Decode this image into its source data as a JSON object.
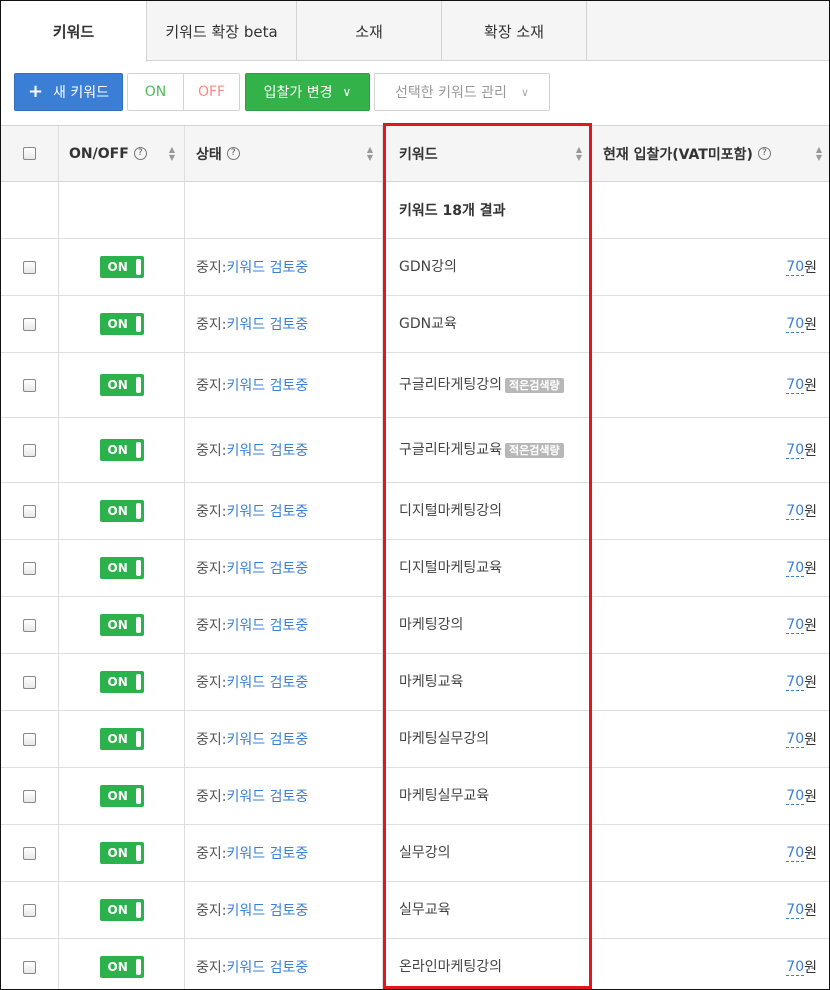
{
  "tabs": [
    {
      "label": "키워드",
      "active": true
    },
    {
      "label": "키워드 확장 beta",
      "active": false
    },
    {
      "label": "소재",
      "active": false
    },
    {
      "label": "확장 소재",
      "active": false
    }
  ],
  "toolbar": {
    "new_keyword": "새 키워드",
    "on": "ON",
    "off": "OFF",
    "bid_change": "입찰가 변경",
    "manage_selected": "선택한 키워드 관리"
  },
  "columns": {
    "onoff": "ON/OFF",
    "status": "상태",
    "keyword": "키워드",
    "bid": "현재 입찰가(VAT미포함)"
  },
  "result_summary": "키워드 18개 결과",
  "status_prefix": "중지:",
  "status_link": "키워드 검토중",
  "toggle_label": "ON",
  "bid_unit": "원",
  "low_volume_badge": "적은검색량",
  "rows": [
    {
      "keyword": "GDN강의",
      "bid": "70"
    },
    {
      "keyword": "GDN교육",
      "bid": "70"
    },
    {
      "keyword": "구글리타게팅강의",
      "bid": "70",
      "low_volume": true
    },
    {
      "keyword": "구글리타게팅교육",
      "bid": "70",
      "low_volume": true
    },
    {
      "keyword": "디지털마케팅강의",
      "bid": "70"
    },
    {
      "keyword": "디지털마케팅교육",
      "bid": "70"
    },
    {
      "keyword": "마케팅강의",
      "bid": "70"
    },
    {
      "keyword": "마케팅교육",
      "bid": "70"
    },
    {
      "keyword": "마케팅실무강의",
      "bid": "70"
    },
    {
      "keyword": "마케팅실무교육",
      "bid": "70"
    },
    {
      "keyword": "실무강의",
      "bid": "70"
    },
    {
      "keyword": "실무교육",
      "bid": "70"
    },
    {
      "keyword": "온라인마케팅강의",
      "bid": "70"
    }
  ],
  "colors": {
    "primary_blue": "#3a7fd5",
    "toggle_green": "#2bb24c",
    "highlight_red": "#e3161b"
  }
}
